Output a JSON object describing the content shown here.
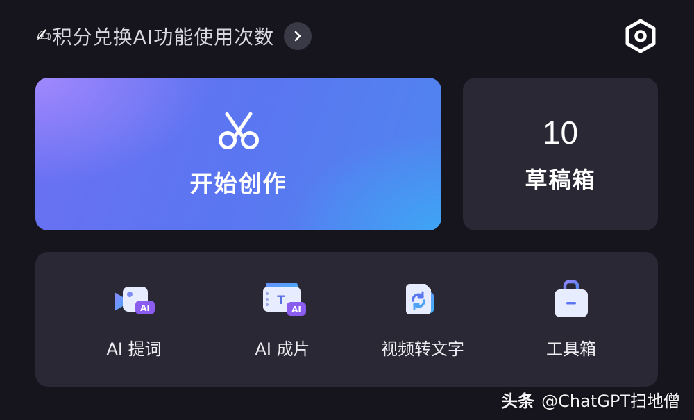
{
  "header": {
    "promo_icon": "✍",
    "promo_text": "积分兑换AI功能使用次数",
    "chevron_icon": "chevron-right-icon",
    "settings_icon": "hexagon-settings-icon"
  },
  "create_card": {
    "icon": "scissors-icon",
    "label": "开始创作",
    "gradient_colors": [
      "#a88cff",
      "#5b76f1",
      "#3caaf5"
    ]
  },
  "drafts_card": {
    "count": "10",
    "label": "草稿箱"
  },
  "tools": [
    {
      "icon": "ai-prompt-video-icon",
      "label": "AI 提词"
    },
    {
      "icon": "ai-film-icon",
      "label": "AI 成片"
    },
    {
      "icon": "video-to-text-icon",
      "label": "视频转文字"
    },
    {
      "icon": "toolbox-icon",
      "label": "工具箱"
    }
  ],
  "watermark": {
    "brand": "头条",
    "handle": "@ChatGPT扫地僧"
  },
  "colors": {
    "background": "#16151d",
    "card": "#292834",
    "accent_purple": "#7b6cf0",
    "accent_blue": "#3d7ff0"
  }
}
